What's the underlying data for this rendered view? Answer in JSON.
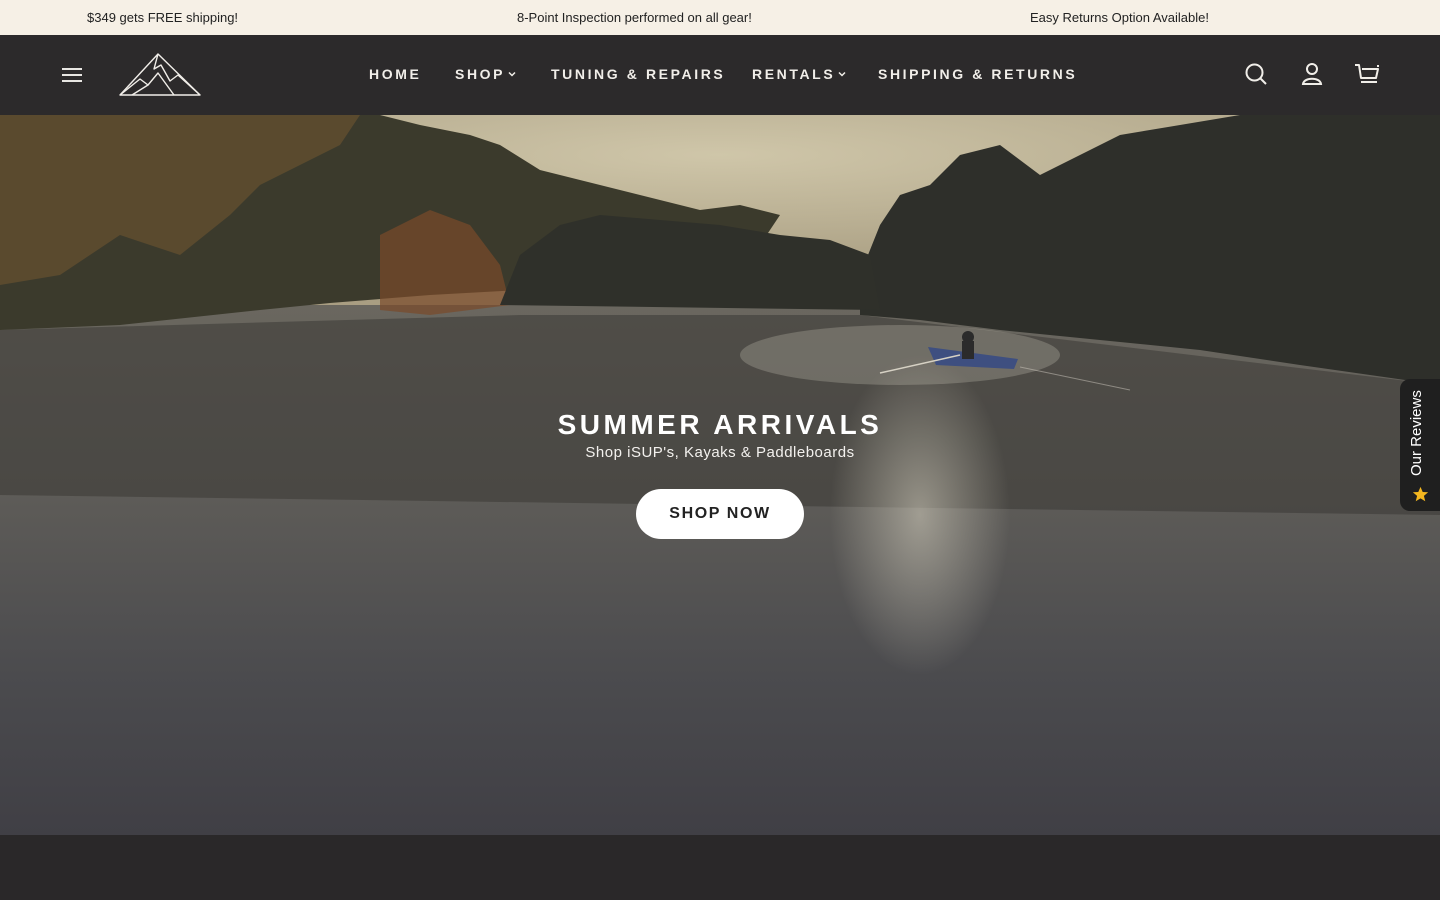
{
  "announcement": {
    "items": [
      "$349 gets FREE shipping!",
      "8-Point Inspection performed on all gear!",
      "Easy Returns Option Available!"
    ]
  },
  "header": {
    "nav": [
      {
        "label": "HOME",
        "has_dropdown": false
      },
      {
        "label": "SHOP",
        "has_dropdown": true
      },
      {
        "label": "TUNING & REPAIRS",
        "has_dropdown": false
      },
      {
        "label": "RENTALS",
        "has_dropdown": true
      },
      {
        "label": "SHIPPING & RETURNS",
        "has_dropdown": false
      }
    ],
    "icons": [
      "menu-icon",
      "mountain-logo",
      "search-icon",
      "account-icon",
      "cart-icon"
    ]
  },
  "hero": {
    "title": "SUMMER ARRIVALS",
    "subtitle": "Shop iSUP's, Kayaks & Paddleboards",
    "cta_label": "SHOP NOW"
  },
  "reviews_tab": {
    "label": "Our Reviews",
    "icon": "star-icon"
  },
  "colors": {
    "announcement_bg": "#f6f0e6",
    "header_bg": "#2c2a2b",
    "cta_bg": "#ffffff",
    "star": "#f3b61f"
  }
}
